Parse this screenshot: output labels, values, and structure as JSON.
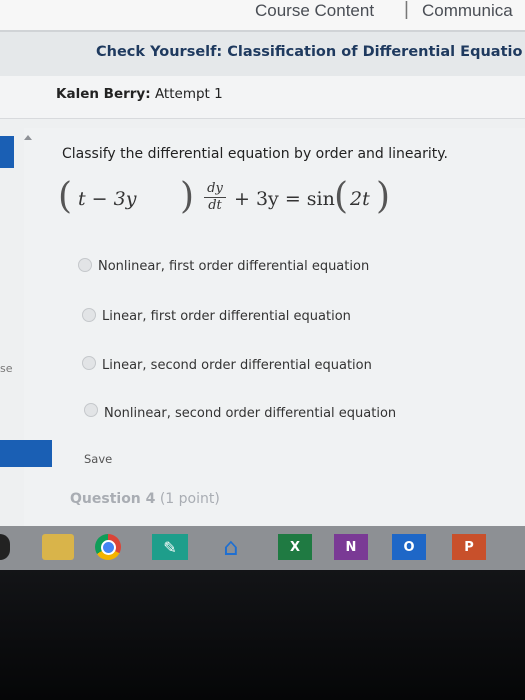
{
  "topnav": {
    "tab_course": "Course Content",
    "separator": "|",
    "tab_communicate": "Communica"
  },
  "page": {
    "title": "Check Yourself: Classification of Differential Equatio",
    "student_name": "Kalen Berry:",
    "attempt_label": "Attempt 1"
  },
  "question": {
    "prompt": "Classify the differential equation by order and linearity.",
    "equation": {
      "lhs_inner": "t − 3y",
      "deriv_num": "dy",
      "deriv_den": "dt",
      "middle": "+ 3y = sin",
      "rhs_inner": "2t"
    },
    "options": [
      "Nonlinear, first order differential equation",
      "Linear, first order differential equation",
      "Linear, second order differential equation",
      "Nonlinear, second order differential equation"
    ],
    "save_label": "Save"
  },
  "sidebar": {
    "clipped_text": "se"
  },
  "next_question": {
    "label": "Question 4",
    "points": "(1 point)"
  },
  "taskbar": {
    "excel_glyph": "X",
    "onenote_glyph": "N",
    "outlook_glyph": "O",
    "ppt_glyph": "P",
    "icons": [
      "folder-icon",
      "chrome-icon",
      "teal-app-icon",
      "home-icon",
      "excel-icon",
      "onenote-icon",
      "outlook-icon",
      "powerpoint-icon"
    ]
  },
  "colors": {
    "accent": "#1a5fb4",
    "title_text": "#1f3a5f"
  }
}
